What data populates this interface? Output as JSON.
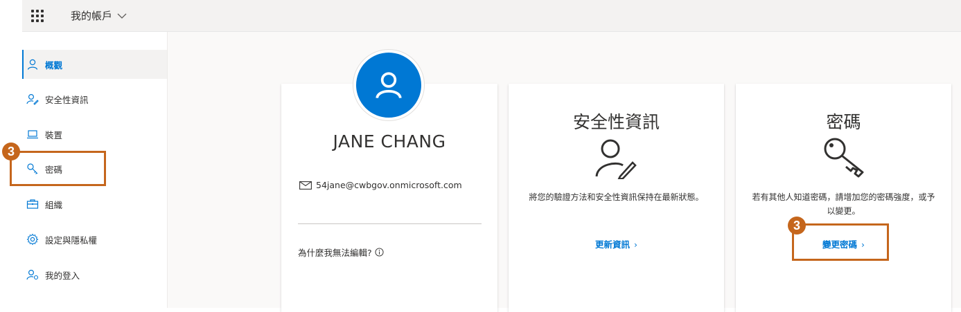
{
  "header": {
    "app_title": "我的帳戶"
  },
  "sidebar": {
    "items": [
      {
        "label": "概觀",
        "icon": "person-icon"
      },
      {
        "label": "安全性資訊",
        "icon": "security-info-icon"
      },
      {
        "label": "裝置",
        "icon": "laptop-icon"
      },
      {
        "label": "密碼",
        "icon": "key-icon"
      },
      {
        "label": "組織",
        "icon": "briefcase-icon"
      },
      {
        "label": "設定與隱私權",
        "icon": "gear-icon"
      },
      {
        "label": "我的登入",
        "icon": "sign-in-icon"
      }
    ]
  },
  "profile": {
    "name": "JANE CHANG",
    "email": "54jane@cwbgov.onmicrosoft.com",
    "why_cant_edit": "為什麼我無法編輯?"
  },
  "security_card": {
    "title": "安全性資訊",
    "description": "將您的驗證方法和安全性資訊保持在最新狀態。",
    "link": "更新資訊"
  },
  "password_card": {
    "title": "密碼",
    "description": "若有其他人知道密碼，請增加您的密碼強度，或予以變更。",
    "link": "變更密碼"
  },
  "callouts": {
    "sidebar_badge": "3",
    "card_badge": "3"
  },
  "colors": {
    "accent": "#0078d4",
    "callout": "#c5661c"
  }
}
